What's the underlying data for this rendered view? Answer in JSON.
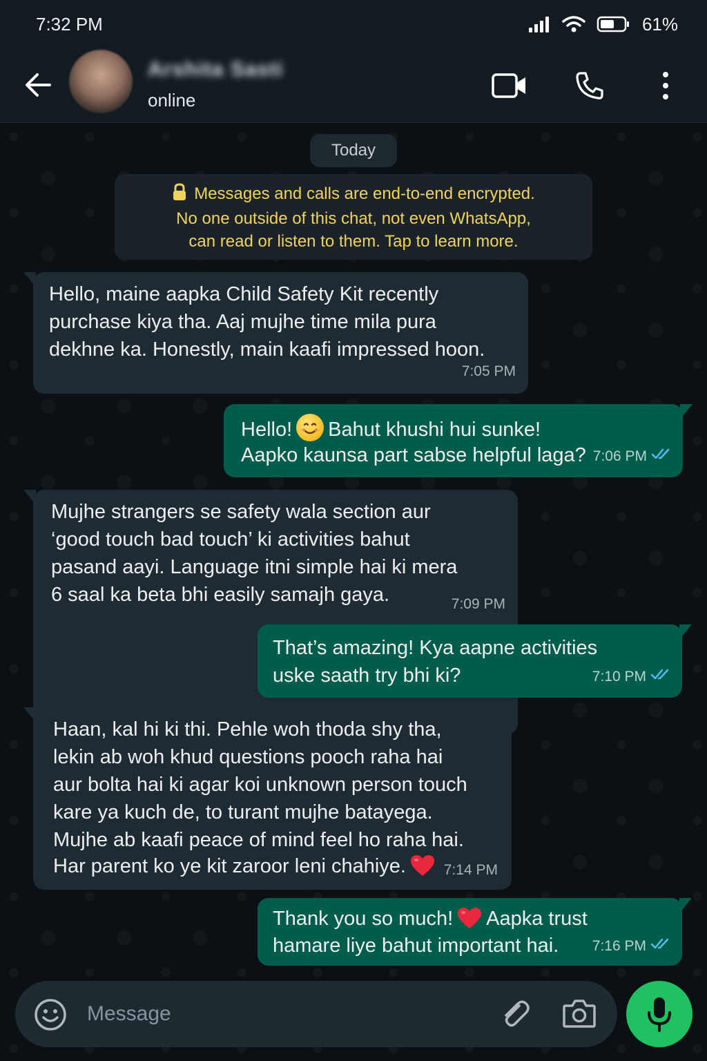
{
  "status_bar": {
    "time": "7:32 PM",
    "battery": "61%"
  },
  "header": {
    "contact_name": "Arshita Sasti",
    "contact_status": "online"
  },
  "chat": {
    "date_label": "Today",
    "encryption_notice": "Messages and calls are end-to-end encrypted.\nNo one outside of this chat, not even WhatsApp,\ncan read or listen to them. Tap to learn more.",
    "messages": [
      {
        "direction": "incoming",
        "text": "Hello, maine aapka Child Safety Kit recently\npurchase kiya tha. Aaj mujhe time mila pura\ndekhne ka. Honestly, main kaafi impressed hoon.",
        "time": "7:05 PM"
      },
      {
        "direction": "outgoing",
        "text_before_emoji": "Hello!",
        "emoji": "smiling-face",
        "text_after_emoji": "Bahut khushi hui sunke!",
        "text_line2": "Aapko kaunsa part sabse helpful laga?",
        "time": "7:06 PM",
        "read": true
      },
      {
        "direction": "incoming",
        "text": "Mujhe strangers se safety wala section aur\n‘good touch bad touch’ ki activities bahut\npasand aayi. Language itni simple hai ki mera\n6 saal ka beta bhi easily samajh gaya.",
        "time": "7:09 PM"
      },
      {
        "direction": "outgoing",
        "text": "That’s amazing! Kya aapne activities\nuske saath try bhi ki?",
        "time": "7:10 PM",
        "read": true
      },
      {
        "direction": "incoming",
        "text": "Haan, kal hi ki thi. Pehle woh thoda shy tha,\nlekin ab woh khud questions pooch raha hai\naur bolta hai ki agar koi unknown person touch\nkare ya kuch de, to turant mujhe batayega.\nMujhe ab kaafi peace of mind feel ho raha hai.",
        "text_last_line": "Har parent ko ye kit zaroor leni chahiye.",
        "emoji": "red-heart",
        "time": "7:14 PM"
      },
      {
        "direction": "outgoing",
        "text_before_emoji": "Thank you so much!",
        "emoji": "red-heart",
        "text_after_emoji": "Aapka trust",
        "text_line2": "hamare liye bahut important hai.",
        "time": "7:16 PM",
        "read": true
      }
    ]
  },
  "composer": {
    "placeholder": "Message"
  },
  "colors": {
    "background": "#0b1014",
    "header": "#121b22",
    "incoming_bubble": "#1f2b32",
    "outgoing_bubble": "#005c4b",
    "notice_text": "#f0d35f",
    "read_ticks": "#53bdeb",
    "mic_button": "#21c063"
  },
  "icons": [
    "signal-icon",
    "wifi-icon",
    "battery-icon",
    "back-arrow-icon",
    "video-call-icon",
    "voice-call-icon",
    "more-options-icon",
    "lock-icon",
    "double-check-icon",
    "emoji-icon",
    "attach-icon",
    "camera-icon",
    "mic-icon"
  ]
}
